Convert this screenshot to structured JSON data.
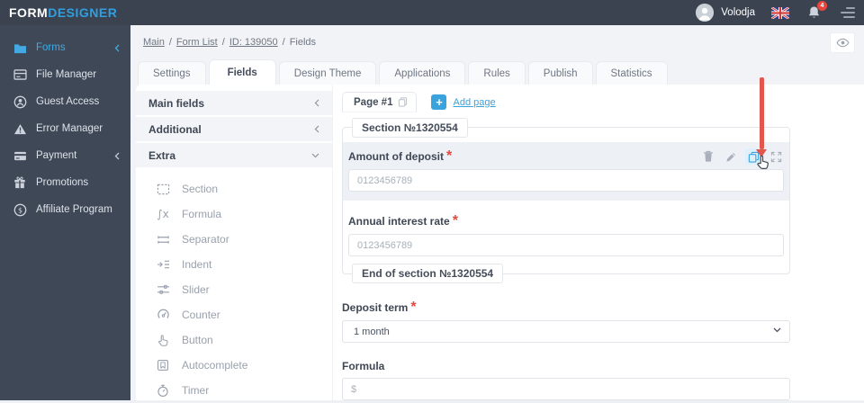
{
  "colors": {
    "accent_blue": "#3aa2dd",
    "header_bg": "#3b4351",
    "sidebar_bg": "#3f4857",
    "arrow_red": "#e2564e",
    "highlight_row": "#edf0f5",
    "required_red": "#e6493f"
  },
  "header": {
    "logo_form": "FORM",
    "logo_designer": "DESIGNER",
    "user_name": "Volodja",
    "notification_count": "4",
    "icons": [
      "avatar",
      "uk-flag-icon",
      "bell-icon",
      "menu-icon"
    ]
  },
  "sidebar": {
    "items": [
      {
        "label": "Forms",
        "icon": "folder-icon",
        "active": true,
        "has_chevron": true
      },
      {
        "label": "File Manager",
        "icon": "file-manager-icon"
      },
      {
        "label": "Guest Access",
        "icon": "guest-access-icon"
      },
      {
        "label": "Error Manager",
        "icon": "error-manager-icon"
      },
      {
        "label": "Payment",
        "icon": "payment-icon",
        "has_chevron": true
      },
      {
        "label": "Promotions",
        "icon": "gift-icon"
      },
      {
        "label": "Affiliate Program",
        "icon": "dollar-circle-icon"
      }
    ]
  },
  "breadcrumb": {
    "links": [
      "Main",
      "Form List",
      "ID: 139050"
    ],
    "current": "Fields",
    "separator": "/"
  },
  "tabs": {
    "active": "Fields",
    "items": [
      "Settings",
      "Fields",
      "Design Theme",
      "Applications",
      "Rules",
      "Publish",
      "Statistics"
    ]
  },
  "fields_panel": {
    "groups": [
      {
        "label": "Main fields",
        "state": "collapsed"
      },
      {
        "label": "Additional",
        "state": "collapsed"
      },
      {
        "label": "Extra",
        "state": "expanded"
      }
    ],
    "extra_items": [
      {
        "label": "Section",
        "icon": "section-icon"
      },
      {
        "label": "Formula",
        "icon": "formula-icon",
        "glyph": "∫x"
      },
      {
        "label": "Separator",
        "icon": "separator-icon"
      },
      {
        "label": "Indent",
        "icon": "indent-icon"
      },
      {
        "label": "Slider",
        "icon": "slider-icon"
      },
      {
        "label": "Counter",
        "icon": "counter-icon"
      },
      {
        "label": "Button",
        "icon": "button-icon"
      },
      {
        "label": "Autocomplete",
        "icon": "autocomplete-icon"
      },
      {
        "label": "Timer",
        "icon": "timer-icon"
      }
    ]
  },
  "canvas": {
    "page_tab": "Page #1",
    "plus": "+",
    "add_page": "Add page",
    "required_marker": "*",
    "section_title": "Section №1320554",
    "section_end_title": "End of section №1320554",
    "action_icons": [
      "trash-icon",
      "pencil-icon",
      "copy-icon",
      "expand-icon"
    ],
    "fields": {
      "amount": {
        "label": "Amount of deposit",
        "required": true,
        "placeholder": "0123456789"
      },
      "rate": {
        "label": "Annual interest rate",
        "required": true,
        "placeholder": "0123456789"
      },
      "term": {
        "label": "Deposit term",
        "required": true,
        "value": "1 month"
      },
      "formula": {
        "label": "Formula",
        "required": false,
        "placeholder": "$"
      }
    }
  }
}
